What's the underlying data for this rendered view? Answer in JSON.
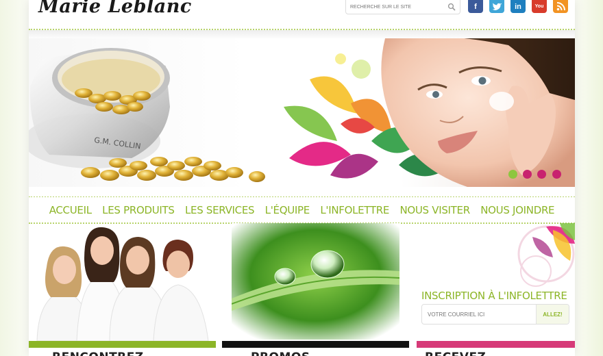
{
  "header": {
    "logo_text": "Marie Leblanc",
    "search_placeholder": "RECHERCHE SUR LE SITE",
    "social": [
      {
        "name": "facebook-icon",
        "glyph": "f",
        "color": "#3b5a9a"
      },
      {
        "name": "twitter-icon",
        "glyph": "t",
        "color": "#3fa6d8"
      },
      {
        "name": "linkedin-icon",
        "glyph": "in",
        "color": "#1e7fbf"
      },
      {
        "name": "youtube-icon",
        "glyph": "You",
        "color": "#d83b2b"
      },
      {
        "name": "rss-icon",
        "glyph": "",
        "color": "#f29323"
      }
    ]
  },
  "hero": {
    "jar_label": "G.M. COLLIN",
    "slides": 4,
    "active_slide": 1
  },
  "nav": {
    "items": [
      "ACCUEIL",
      "LES PRODUITS",
      "LES SERVICES",
      "L'ÉQUIPE",
      "L'INFOLETTRE",
      "NOUS VISITER",
      "NOUS JOINDRE"
    ]
  },
  "newsletter": {
    "title": "INSCRIPTION À L'INFOLETTRE",
    "email_placeholder": "VOTRE COURRIEL ICI",
    "submit_label": "ALLEZ!"
  },
  "columns": [
    {
      "title": "RENCONTREZ",
      "color": "#8cb527"
    },
    {
      "title": "PROMOS",
      "color": "#111111"
    },
    {
      "title": "RECEVEZ",
      "color": "#d63a78"
    }
  ],
  "colors": {
    "accent_green": "#8cb527",
    "accent_pink": "#d63a78",
    "dot_green": "#8dc63f",
    "dot_pink": "#c8236f"
  }
}
